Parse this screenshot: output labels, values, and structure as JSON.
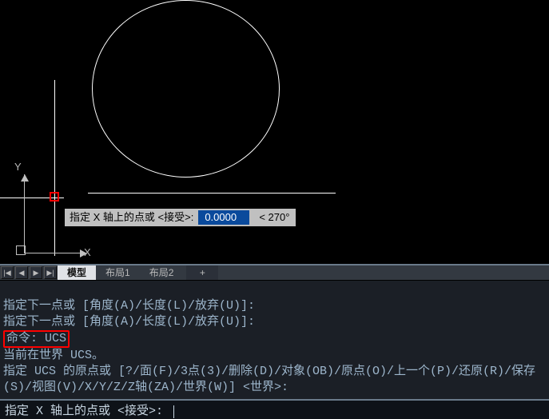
{
  "drawing": {
    "ucs": {
      "x_label": "X",
      "y_label": "Y"
    },
    "dynamic_input": {
      "prompt": "指定 X 轴上的点或 <接受>:",
      "value": "0.0000",
      "angle": "< 270°"
    }
  },
  "tabs": {
    "nav_first": "|◀",
    "nav_prev": "◀",
    "nav_next": "▶",
    "nav_last": "▶|",
    "items": [
      {
        "label": "模型",
        "active": true
      },
      {
        "label": "布局1",
        "active": false
      },
      {
        "label": "布局2",
        "active": false
      }
    ],
    "add": "+"
  },
  "command_history": {
    "line1": "指定下一点或 [角度(A)/长度(L)/放弃(U)]:",
    "line2": "指定下一点或 [角度(A)/长度(L)/放弃(U)]:",
    "line3_hl": "命令: UCS",
    "line4": "当前在世界 UCS。",
    "line5": "指定 UCS 的原点或 [?/面(F)/3点(3)/删除(D)/对象(OB)/原点(O)/上一个(P)/还原(R)/保存(S)/视图(V)/X/Y/Z/Z轴(ZA)/世界(W)] <世界>:"
  },
  "command_line": {
    "prompt": "指定 X 轴上的点或 <接受>: "
  }
}
